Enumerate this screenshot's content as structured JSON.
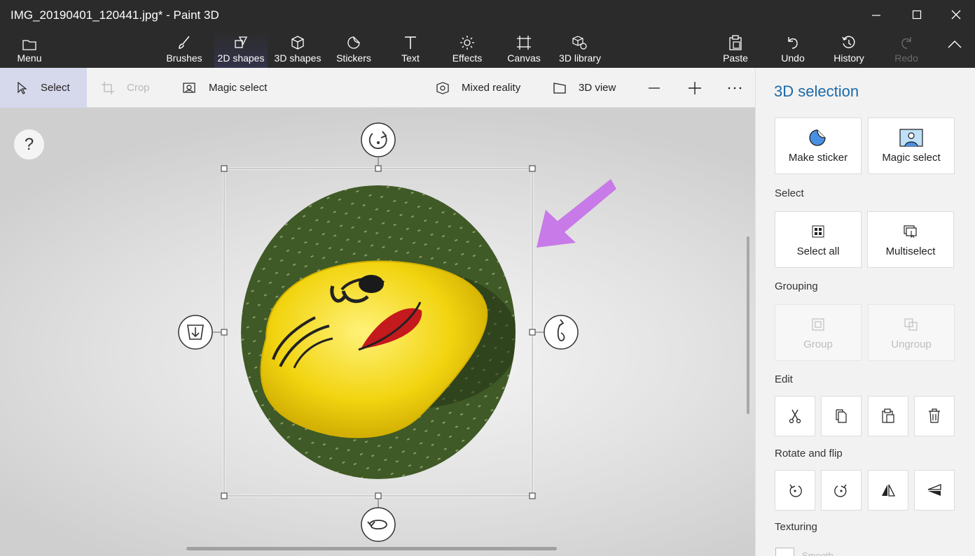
{
  "window": {
    "title": "IMG_20190401_120441.jpg* - Paint 3D",
    "minimize": "—",
    "maximize": "☐",
    "close": "✕"
  },
  "ribbon": {
    "menu": "Menu",
    "tools": [
      {
        "label": "Brushes",
        "icon": "brush-icon"
      },
      {
        "label": "2D shapes",
        "icon": "2d-shapes-icon"
      },
      {
        "label": "3D shapes",
        "icon": "3d-shapes-icon"
      },
      {
        "label": "Stickers",
        "icon": "stickers-icon"
      },
      {
        "label": "Text",
        "icon": "text-icon"
      },
      {
        "label": "Effects",
        "icon": "effects-icon"
      },
      {
        "label": "Canvas",
        "icon": "canvas-icon"
      },
      {
        "label": "3D library",
        "icon": "3d-library-icon"
      }
    ],
    "paste": "Paste",
    "undo": "Undo",
    "history": "History",
    "redo": "Redo"
  },
  "toolbar": {
    "select": "Select",
    "crop": "Crop",
    "magic_select": "Magic select",
    "mixed_reality": "Mixed reality",
    "view_3d": "3D view",
    "zoom_out": "—",
    "zoom_in": "+",
    "more": "···"
  },
  "canvas": {
    "help": "?"
  },
  "panel": {
    "title": "3D selection",
    "make_sticker": "Make sticker",
    "magic_select": "Magic select",
    "select_label": "Select",
    "select_all": "Select all",
    "multiselect": "Multiselect",
    "grouping_label": "Grouping",
    "group": "Group",
    "ungroup": "Ungroup",
    "edit_label": "Edit",
    "rotate_label": "Rotate and flip",
    "texturing_label": "Texturing",
    "smooth": "Smooth"
  },
  "colors": {
    "accent": "#1c6aa8",
    "arrow": "#c77ae8",
    "dark_bar": "#2b2b2b",
    "select_highlight": "#d6d8ec"
  }
}
